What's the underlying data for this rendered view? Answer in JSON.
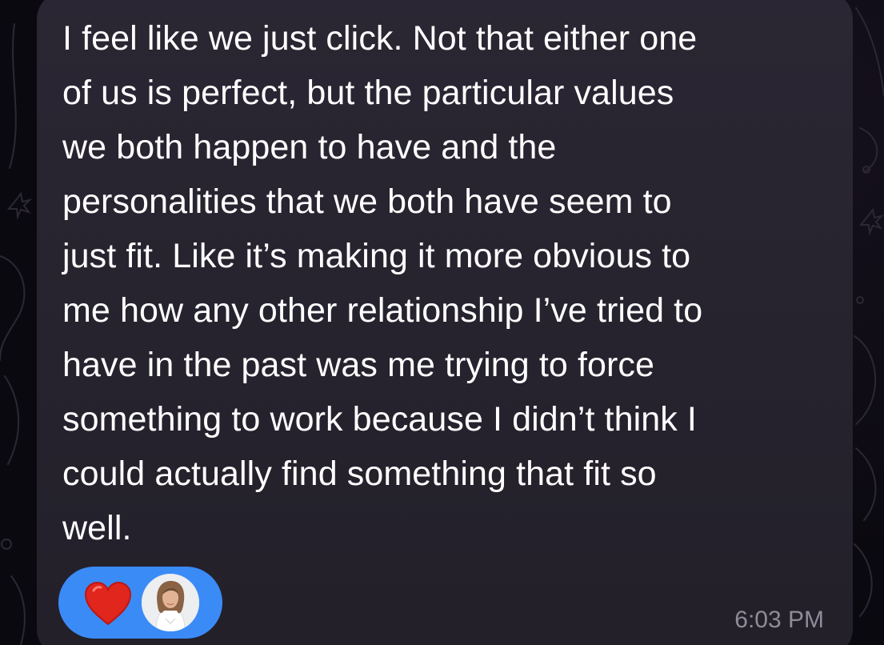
{
  "message": {
    "lines": [
      "I feel like we just click. Not that either one",
      "of us is perfect, but the particular values",
      "we both happen to have and the",
      "personalities that we both have seem to",
      "just fit. Like it’s making it more obvious to",
      "me how any other relationship I’ve tried to",
      "have in the past was me trying to force",
      "something to work because I didn’t think I",
      "could actually find something that fit so",
      "well."
    ],
    "timestamp": "6:03 PM"
  },
  "reaction": {
    "icon": "heart-icon",
    "color": "#e0261d",
    "pill_color": "#3b8bf7"
  },
  "colors": {
    "background": "#0b0910",
    "bubble": "#27232f",
    "text": "#ffffff",
    "timestamp": "#8f8b99"
  }
}
